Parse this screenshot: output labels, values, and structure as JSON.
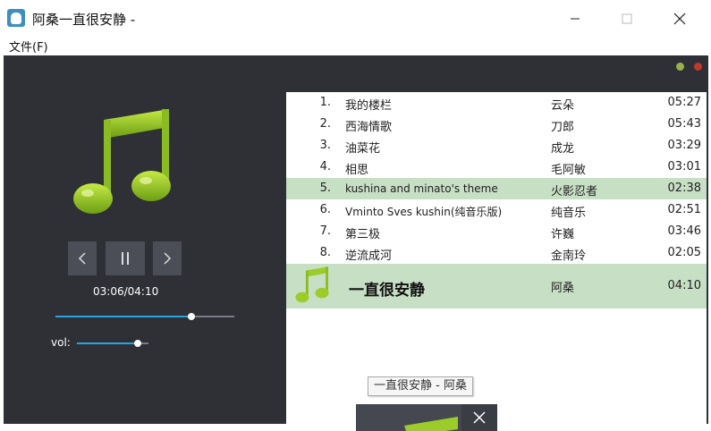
{
  "window": {
    "title": "阿桑一直很安静 -"
  },
  "menu": {
    "file": "文件(F)"
  },
  "player": {
    "time": "03:06/04:10",
    "progress_fraction": 0.76,
    "volume_label": "vol:",
    "volume_fraction": 0.85,
    "indicator_colors": [
      "#9bb04a",
      "#c0392b"
    ]
  },
  "playlist": [
    {
      "num": "1.",
      "title": "我的楼栏",
      "artist": "云朵",
      "duration": "05:27"
    },
    {
      "num": "2.",
      "title": "西海情歌",
      "artist": "刀郎",
      "duration": "05:43"
    },
    {
      "num": "3.",
      "title": "油菜花",
      "artist": "成龙",
      "duration": "03:29"
    },
    {
      "num": "4.",
      "title": "相思",
      "artist": "毛阿敏",
      "duration": "03:01"
    },
    {
      "num": "5.",
      "title": "kushina and minato's theme",
      "artist": "火影忍者",
      "duration": "02:38"
    },
    {
      "num": "6.",
      "title": "Vminto Sves kushin(纯音乐版)",
      "artist": "纯音乐",
      "duration": "02:51"
    },
    {
      "num": "7.",
      "title": "第三极",
      "artist": "许巍",
      "duration": "03:46"
    },
    {
      "num": "8.",
      "title": "逆流成河",
      "artist": "金南玲",
      "duration": "02:05"
    }
  ],
  "now_playing": {
    "title": "一直很安静",
    "artist": "阿桑",
    "duration": "04:10"
  },
  "tooltip": "一直很安静 - 阿桑",
  "colors": {
    "accent": "#29a3e0",
    "selected_row": "#c7dfc4",
    "panel": "#2e3036"
  }
}
